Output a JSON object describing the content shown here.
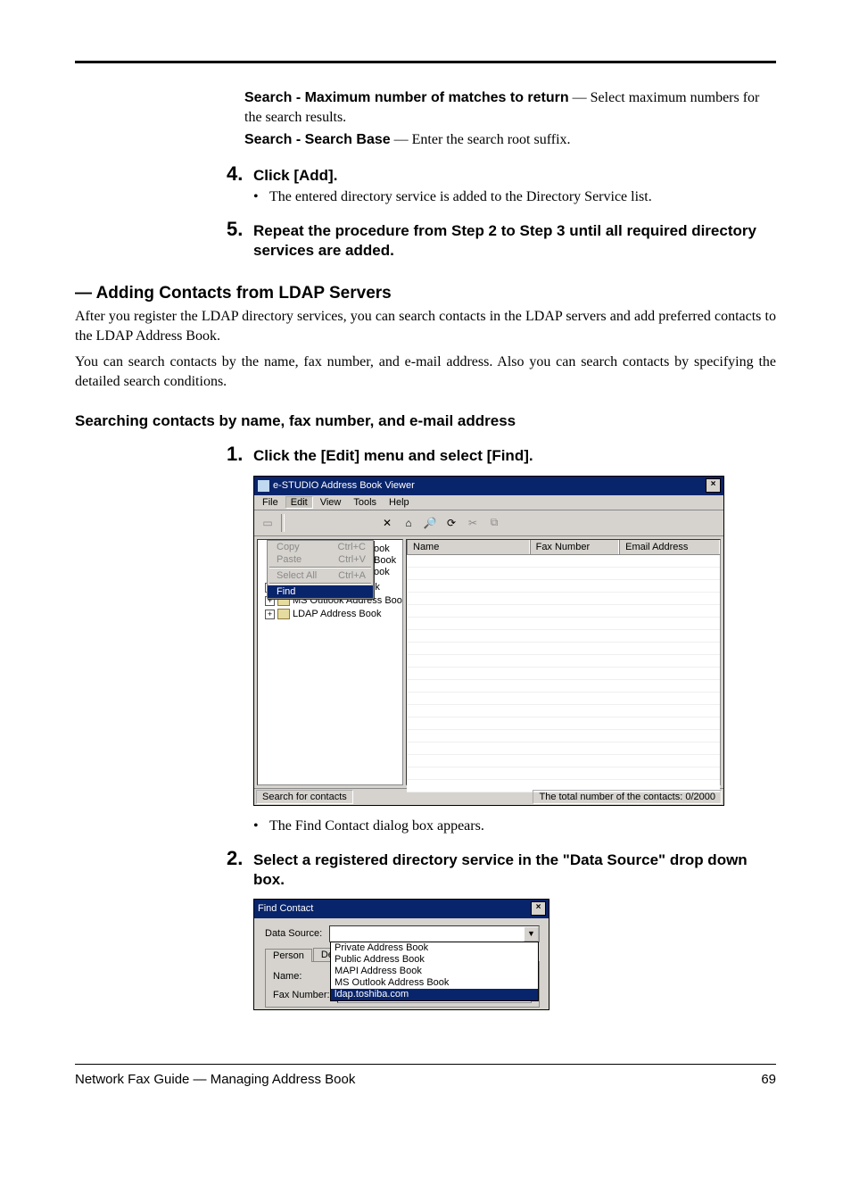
{
  "intro": {
    "search_max_label": "Search - Maximum number of matches to return",
    "search_max_rest": " — Select maximum numbers for the search results.",
    "search_base_label": "Search - Search Base",
    "search_base_rest": " — Enter the search root suffix."
  },
  "steps": {
    "s4_num": "4.",
    "s4_text": "Click [Add].",
    "s4_bullet": "The entered directory service is added to the Directory Service list.",
    "s5_num": "5.",
    "s5_text": "Repeat the procedure from Step 2 to Step 3 until all required directory services are added."
  },
  "section": {
    "heading": "— Adding Contacts from LDAP Servers",
    "p1": "After you register the LDAP directory services, you can search contacts in the LDAP servers and add preferred contacts to the LDAP Address Book.",
    "p2": "You can search contacts by the name, fax number, and e-mail address.  Also you can search con­tacts by specifying the detailed search conditions."
  },
  "subhead": "Searching contacts by name, fax number, and e-mail address",
  "proc": {
    "s1_num": "1.",
    "s1_text": "Click the [Edit] menu and select [Find].",
    "s1_bullet": "The Find Contact dialog box appears.",
    "s2_num": "2.",
    "s2_text": "Select a registered directory service in the \"Data Source\" drop down box."
  },
  "abv": {
    "title": "e-STUDIO Address Book Viewer",
    "close": "×",
    "menu": {
      "file": "File",
      "edit": "Edit",
      "view": "View",
      "tools": "Tools",
      "help": "Help"
    },
    "editmenu": {
      "copy": "Copy",
      "copy_k": "Ctrl+C",
      "paste": "Paste",
      "paste_k": "Ctrl+V",
      "select_all": "Select All",
      "select_all_k": "Ctrl+A",
      "find": "Find"
    },
    "toolbar_icons": {
      "new_card": "▭",
      "delete": "✕",
      "properties": "⌂",
      "find": "🔎",
      "refresh": "⟳",
      "cut": "✂",
      "copy": "⧉"
    },
    "tree_peek": {
      "l1": "ook",
      "l2": "Book",
      "l3": "ook"
    },
    "tree": {
      "mapi": "MAPI Address Book",
      "outlook": "MS Outlook Address Book",
      "ldap": "LDAP Address Book"
    },
    "cols": {
      "name": "Name",
      "fax": "Fax Number",
      "email": "Email Address"
    },
    "status_left": "Search for contacts",
    "status_right": "The total number of the contacts: 0/2000"
  },
  "find": {
    "title": "Find Contact",
    "close": "×",
    "data_source": "Data Source:",
    "tabs": {
      "person": "Person",
      "detail": "Detail Se"
    },
    "name": "Name:",
    "fax": "Fax Number:",
    "options": {
      "o1": "Private Address Book",
      "o2": "Public Address Book",
      "o3": "MAPI Address Book",
      "o4": "MS Outlook Address Book",
      "o5": "ldap.toshiba.com"
    }
  },
  "footer": {
    "left": "Network Fax Guide — Managing Address Book",
    "right": "69"
  },
  "bullet": "•",
  "dropdown_arrow": "▼"
}
